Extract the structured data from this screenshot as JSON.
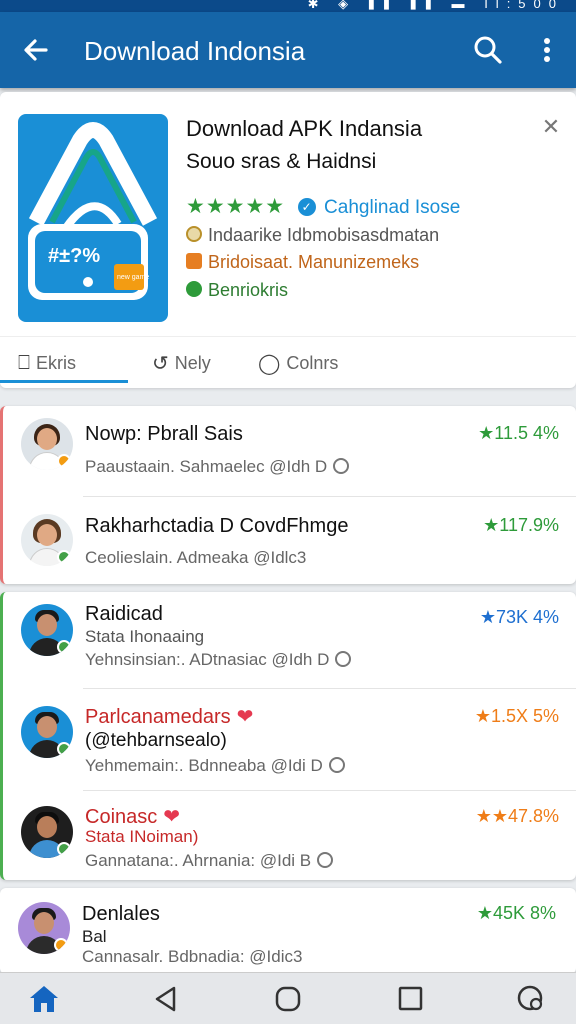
{
  "status_bar": {
    "time": "Il:500"
  },
  "app_bar": {
    "title": "Download Indonsia"
  },
  "app": {
    "name": "Download APK Indansia",
    "developer": "Souo sras & Haidnsi",
    "stars": "★★★★★",
    "rating_label": "Cahglinad Isose",
    "info_1": "Indaarike Idbmobisasdmatan",
    "info_2": "Bridoisaat. Manunizemeks",
    "info_3": "Benriokris",
    "icon_text": "#±?%",
    "icon_tag": "new game",
    "colors": {
      "accent": "#1a8fd6",
      "star": "#2e9b3a",
      "brand": "#1565a8"
    }
  },
  "tabs": [
    {
      "label": "Ekris",
      "icon": "bookmark-icon"
    },
    {
      "label": "Nely",
      "icon": "refresh-icon"
    },
    {
      "label": "Colnrs",
      "icon": "shield-icon"
    }
  ],
  "reviews": [
    {
      "name": "Nowp: Pbrall Sais",
      "meta": "Paaustaain. Sahmaelec @Idh D",
      "rating": "★11.5 4%",
      "rating_color": "#2e9b3a",
      "badge_color": "#f39c12"
    },
    {
      "name": "Rakharhctadia D CovdFhmge",
      "meta": "Ceolieslain. Admeaka @Idlc3",
      "rating": "★117.9%",
      "rating_color": "#2e9b3a",
      "badge_color": "#43a047"
    },
    {
      "name": "Raidicad",
      "sub": "Stata Ihonaaing",
      "meta": "Yehnsinsian:. ADtnasiac @Idh D",
      "rating": "★73K 4%",
      "rating_color": "#1e6fd0",
      "badge_color": "#43a047"
    },
    {
      "name": "Parlcanamedars",
      "sub": "(@tehbarnsealo)",
      "meta": "Yehmemain:. Bdnneaba @Idi D",
      "rating": "★1.5X 5%",
      "rating_color": "#ef7d18",
      "badge_color": "#43a047"
    },
    {
      "name": "Coinasc",
      "sub": "Stata INoiman)",
      "meta": "Gannatana:. Ahrnania: @Idi B",
      "rating": "★★47.8%",
      "rating_color": "#ef7d18",
      "badge_color": "#43a047"
    },
    {
      "name": "Denlales",
      "sub": "Bal",
      "meta": "Cannasalr. Bdbnadia: @Idic3",
      "rating": "★45K 8%",
      "rating_color": "#2e9b3a",
      "badge_color": "#f39c12"
    }
  ]
}
